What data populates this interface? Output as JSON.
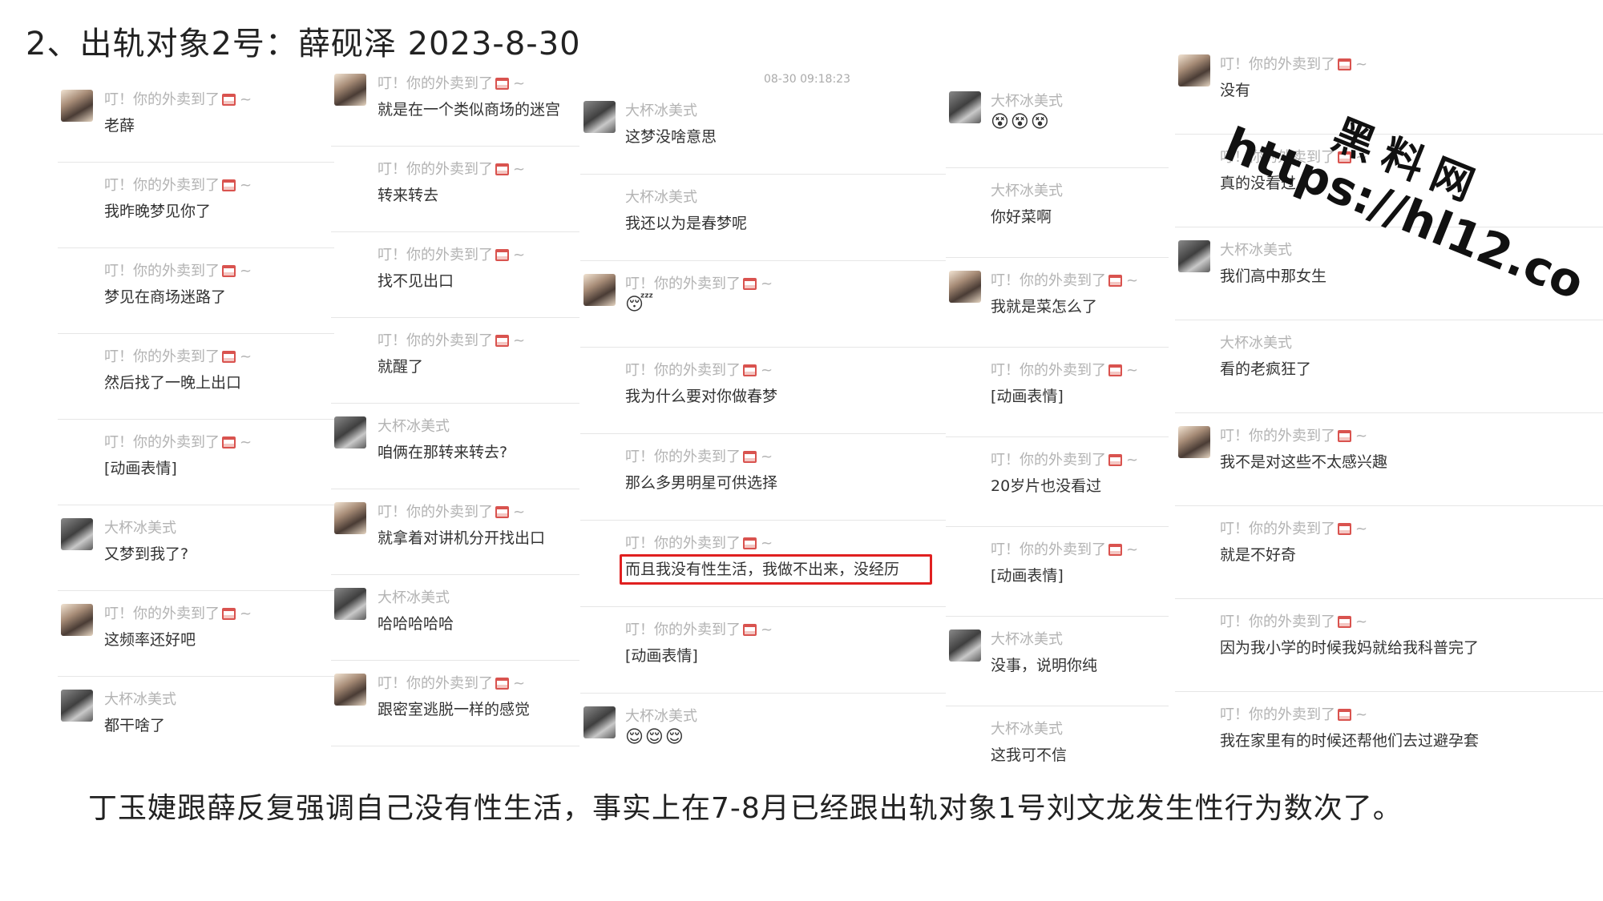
{
  "title": "2、出轨对象2号：薛砚泽  2023-8-30",
  "timestamp": "08-30 09:18:23",
  "sender_names": {
    "her": "叮！你的外卖到了",
    "him": "大杯冰美式",
    "suffix": "~"
  },
  "columns": [
    {
      "messages": [
        {
          "from": "her",
          "text": "老薛"
        },
        {
          "from": "her",
          "text": "我昨晚梦见你了"
        },
        {
          "from": "her",
          "text": "梦见在商场迷路了"
        },
        {
          "from": "her",
          "text": "然后找了一晚上出口"
        },
        {
          "from": "her",
          "text": "[动画表情]"
        },
        {
          "from": "him",
          "text": "又梦到我了?"
        },
        {
          "from": "her",
          "text": "这频率还好吧"
        },
        {
          "from": "him",
          "text": "都干啥了"
        }
      ]
    },
    {
      "messages": [
        {
          "from": "her",
          "text": "就是在一个类似商场的迷宫"
        },
        {
          "from": "her",
          "text": "转来转去"
        },
        {
          "from": "her",
          "text": "找不见出口"
        },
        {
          "from": "her",
          "text": "就醒了"
        },
        {
          "from": "him",
          "text": "咱俩在那转来转去?"
        },
        {
          "from": "her",
          "text": "就拿着对讲机分开找出口"
        },
        {
          "from": "him",
          "text": "哈哈哈哈哈"
        },
        {
          "from": "her",
          "text": "跟密室逃脱一样的感觉"
        }
      ]
    },
    {
      "messages": [
        {
          "from": "him",
          "text": "这梦没啥意思"
        },
        {
          "from": "him",
          "text": "我还以为是春梦呢"
        },
        {
          "from": "her",
          "text": "😴"
        },
        {
          "from": "her",
          "text": "我为什么要对你做春梦"
        },
        {
          "from": "her",
          "text": "那么多男明星可供选择"
        },
        {
          "from": "her",
          "text": "而且我没有性生活，我做不出来，没经历"
        },
        {
          "from": "her",
          "text": "[动画表情]"
        },
        {
          "from": "him",
          "text": "😌😌😌"
        }
      ]
    },
    {
      "messages": [
        {
          "from": "him",
          "text": "😵😵😵"
        },
        {
          "from": "him",
          "text": "你好菜啊"
        },
        {
          "from": "her",
          "text": "我就是菜怎么了"
        },
        {
          "from": "her",
          "text": "[动画表情]"
        },
        {
          "from": "her",
          "text": "20岁片也没看过"
        },
        {
          "from": "her",
          "text": "[动画表情]"
        },
        {
          "from": "him",
          "text": "没事，说明你纯"
        },
        {
          "from": "him",
          "text": "这我可不信"
        }
      ]
    },
    {
      "messages": [
        {
          "from": "her",
          "text": "没有"
        },
        {
          "from": "her",
          "text": "真的没看过"
        },
        {
          "from": "him",
          "text": "我们高中那女生"
        },
        {
          "from": "him",
          "text": "看的老疯狂了"
        },
        {
          "from": "her",
          "text": "我不是对这些不太感兴趣"
        },
        {
          "from": "her",
          "text": "就是不好奇"
        },
        {
          "from": "her",
          "text": "因为我小学的时候我妈就给我科普完了"
        },
        {
          "from": "her",
          "text": "我在家里有的时候还帮他们去过避孕套"
        }
      ]
    }
  ],
  "caption": "丁玉婕跟薛反复强调自己没有性生活，事实上在7-8月已经跟出轨对象1号刘文龙发生性行为数次了。",
  "watermark": {
    "cn": "黑料网",
    "url": "https://hl12.co"
  }
}
